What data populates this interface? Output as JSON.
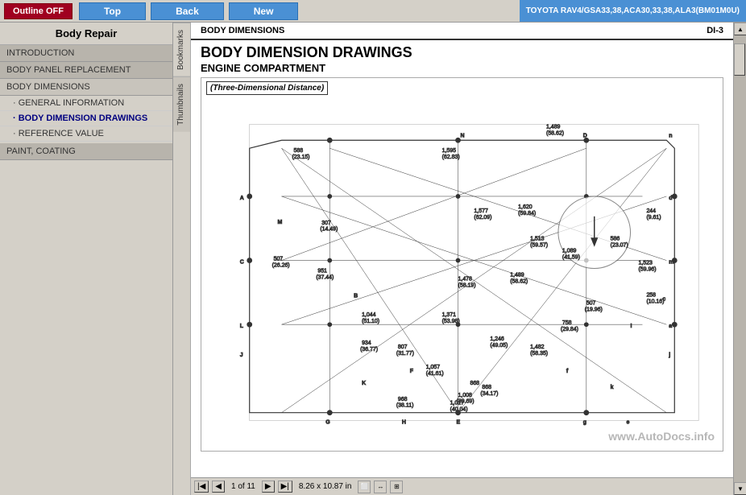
{
  "topbar": {
    "outline_btn": "Outline OFF",
    "nav_top": "Top",
    "nav_back": "Back",
    "nav_new": "New",
    "title": "TOYOTA RAV4/GSA33,38,ACA30,33,38,ALA3",
    "title2": "(BM01M0U)"
  },
  "sidebar": {
    "title": "Body Repair",
    "items": [
      {
        "label": "INTRODUCTION",
        "type": "section"
      },
      {
        "label": "BODY PANEL REPLACEMENT",
        "type": "section"
      },
      {
        "label": "BODY DIMENSIONS",
        "type": "section",
        "active": true
      },
      {
        "label": "GENERAL INFORMATION",
        "type": "item"
      },
      {
        "label": "BODY DIMENSION DRAWINGS",
        "type": "item",
        "active": true
      },
      {
        "label": "REFERENCE VALUE",
        "type": "item"
      },
      {
        "label": "PAINT, COATING",
        "type": "section"
      }
    ]
  },
  "tabs": [
    {
      "label": "Bookmarks"
    },
    {
      "label": "Thumbnails"
    }
  ],
  "document": {
    "section": "BODY DIMENSIONS",
    "page_ref": "DI-3",
    "title": "BODY DIMENSION DRAWINGS",
    "subtitle": "ENGINE COMPARTMENT",
    "diagram_label": "(Three-Dimensional Distance)",
    "watermark": "www.AutoDocs.info"
  },
  "statusbar": {
    "page_current": "1",
    "page_total": "11",
    "size": "8.26 x 10.87 in"
  }
}
